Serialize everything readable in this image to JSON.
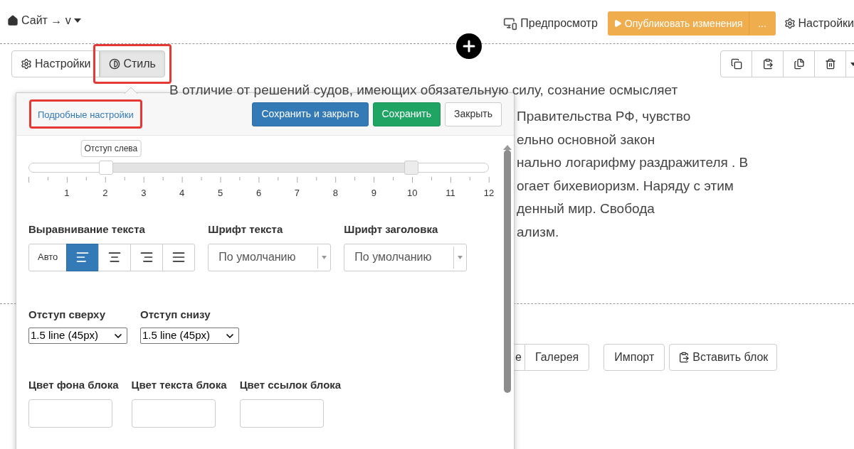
{
  "topbar": {
    "breadcrumb": "Сайт → v",
    "preview": "Предпросмотр",
    "publish": "Опубликовать изменения",
    "publish_more": "...",
    "settings": "Настройки"
  },
  "block_tabs": [
    {
      "label": "Настройки",
      "selected": false,
      "highlighted": false
    },
    {
      "label": "Стиль",
      "selected": true,
      "highlighted": true
    }
  ],
  "content_lines": [
    "В отличие от решений судов, имеющих обязательную силу, сознание осмысляет",
    "Правительства РФ, чувство",
    "ельно основной закон",
    "нально логарифму раздражителя . В",
    "огает бихевиоризм. Наряду с этим",
    "денный мир. Свобода",
    "ализм."
  ],
  "bottom_buttons": [
    {
      "label": "е",
      "kind": "partial"
    },
    {
      "label": "Галерея",
      "kind": "group"
    },
    {
      "label": "Импорт",
      "kind": "plain"
    },
    {
      "label": "Вставить блок",
      "kind": "paste"
    }
  ],
  "panel": {
    "link": {
      "label": "Подробные настройки",
      "highlighted": true
    },
    "buttons": [
      {
        "label": "Сохранить и закрыть",
        "kind": "primary"
      },
      {
        "label": "Сохранить",
        "kind": "success"
      },
      {
        "label": "Закрыть",
        "kind": "default"
      }
    ],
    "slider": {
      "tooltip": "Отступ слева",
      "thumbs": [
        {
          "level": 0.1667
        },
        {
          "level": 0.8333
        }
      ],
      "labels": [
        "1",
        "2",
        "3",
        "4",
        "5",
        "6",
        "7",
        "8",
        "9",
        "10",
        "11",
        "12"
      ]
    },
    "align": {
      "label": "Выравнивание текста",
      "options": [
        {
          "kind": "text",
          "label": "Авто",
          "selected": false
        },
        {
          "kind": "left",
          "selected": true
        },
        {
          "kind": "center",
          "selected": false
        },
        {
          "kind": "right",
          "selected": false
        },
        {
          "kind": "justify",
          "selected": false
        }
      ]
    },
    "font_selects": [
      {
        "label": "Шрифт текста",
        "value": "По умолчанию"
      },
      {
        "label": "Шрифт заголовка",
        "value": "По умолчанию"
      }
    ],
    "spacing": [
      {
        "label": "Отступ сверху",
        "value": "1.5 line (45px)"
      },
      {
        "label": "Отступ снизу",
        "value": "1.5 line (45px)"
      }
    ],
    "colors": [
      {
        "label": "Цвет фона блока"
      },
      {
        "label": "Цвет текста блока"
      },
      {
        "label": "Цвет ссылок блока"
      }
    ]
  }
}
